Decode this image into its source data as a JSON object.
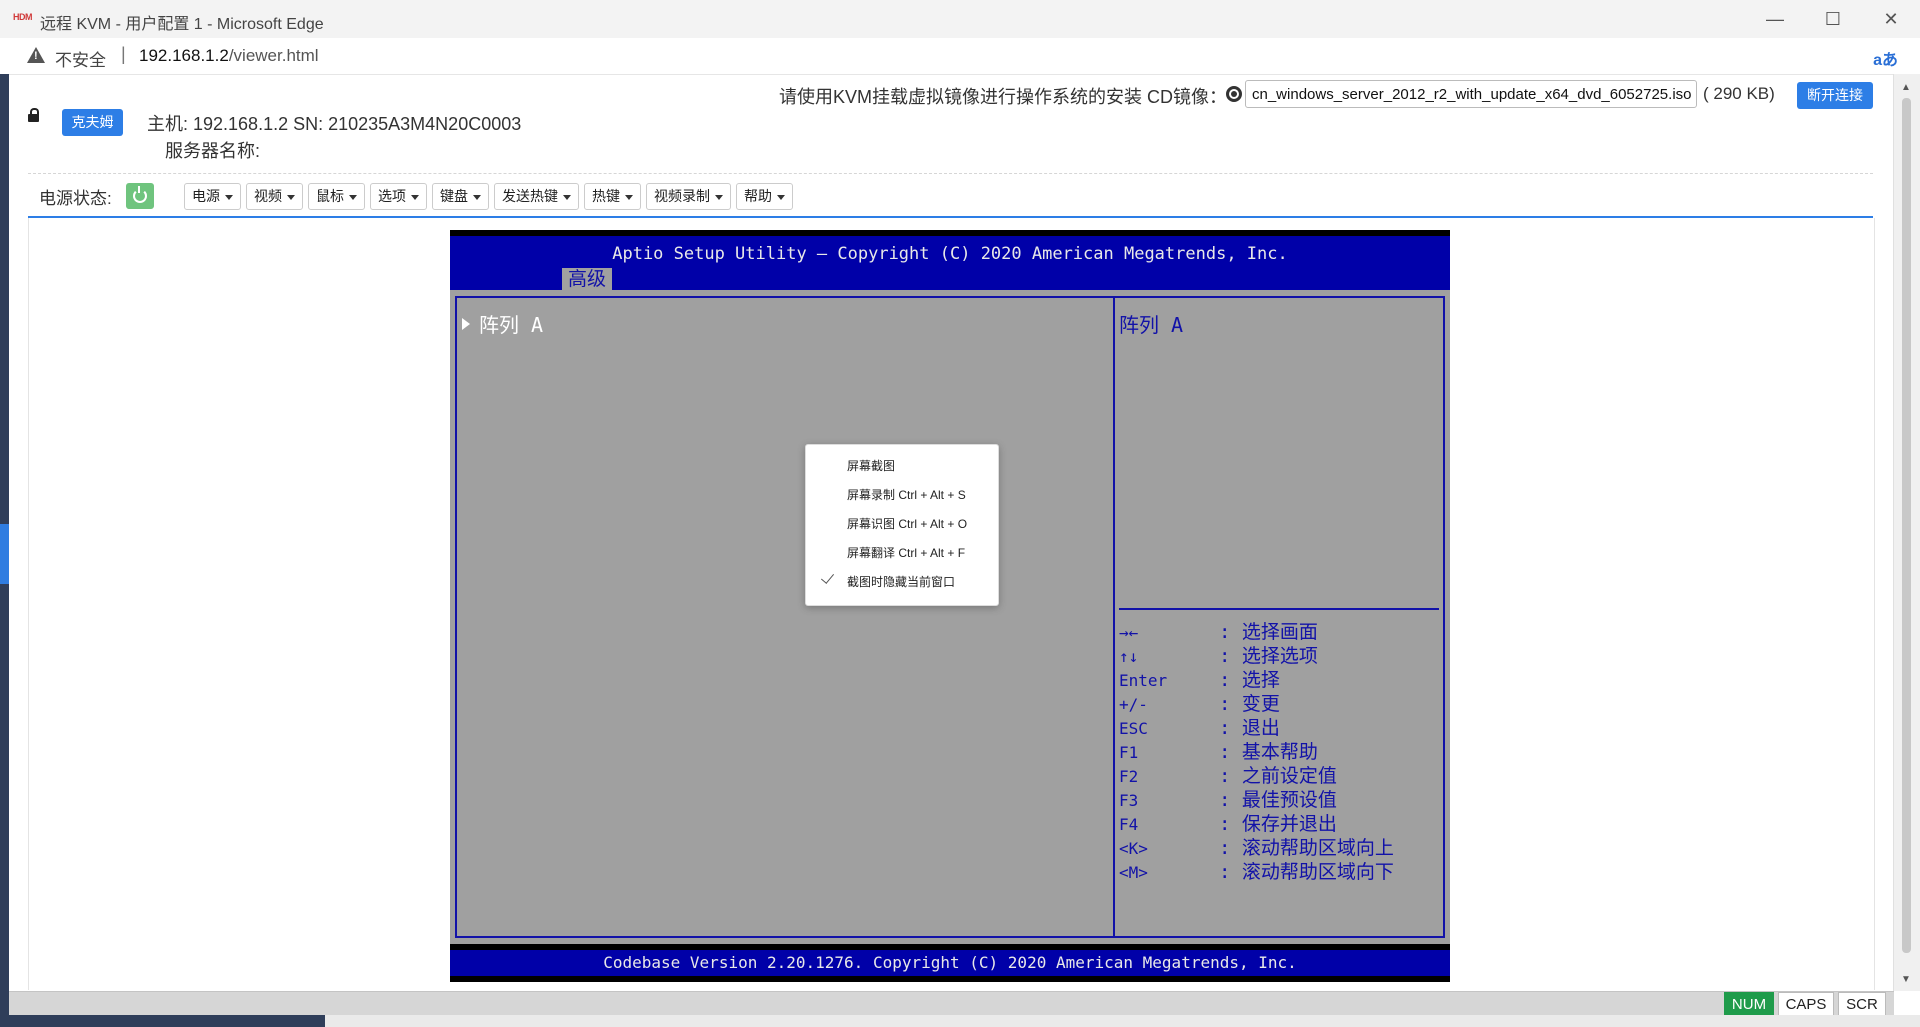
{
  "window": {
    "logo_text": "HDM",
    "title": "远程 KVM - 用户配置 1 - Microsoft Edge",
    "controls": {
      "minimize": "—",
      "maximize": "☐",
      "close": "✕"
    }
  },
  "address_bar": {
    "security_label": "不安全",
    "separator": "|",
    "url_host": "192.168.1.2",
    "url_path": "/viewer.html",
    "read_aloud_icon": "aあ"
  },
  "header": {
    "username": "克夫姆",
    "host_label": "主机:   192.168.1.2  SN:   210235A3M4N20C0003",
    "server_name_label": "服务器名称:",
    "notice": "请使用KVM挂载虚拟镜像进行操作系统的安装   CD镜像：",
    "iso_name": "cn_windows_server_2012_r2_with_update_x64_dvd_6052725.iso",
    "iso_size": "( 290 KB)",
    "disconnect": "断开连接"
  },
  "toolbar": {
    "power_status_label": "电源状态:",
    "power_color": "#6fc47e",
    "menus": [
      "电源",
      "视频",
      "鼠标",
      "选项",
      "键盘",
      "发送热键",
      "热键",
      "视频录制",
      "帮助"
    ]
  },
  "bios": {
    "title": "Aptio Setup Utility – Copyright (C) 2020 American Megatrends, Inc.",
    "tab": "高级",
    "left_item": "阵列 A",
    "help_title": "阵列 A",
    "keys": [
      {
        "key": "→←",
        "desc": ": 选择画面"
      },
      {
        "key": "↑↓",
        "desc": ": 选择选项"
      },
      {
        "key": "Enter",
        "desc": ": 选择"
      },
      {
        "key": "+/-",
        "desc": ": 变更"
      },
      {
        "key": "ESC",
        "desc": ": 退出"
      },
      {
        "key": "F1",
        "desc": ": 基本帮助"
      },
      {
        "key": "F2",
        "desc": ": 之前设定值"
      },
      {
        "key": "F3",
        "desc": ": 最佳预设值"
      },
      {
        "key": "F4",
        "desc": ": 保存并退出"
      },
      {
        "key": "<K>",
        "desc": ": 滚动帮助区域向上"
      },
      {
        "key": "<M>",
        "desc": ": 滚动帮助区域向下"
      }
    ],
    "footer": "Codebase Version 2.20.1276. Copyright (C) 2020 American Megatrends, Inc.",
    "colors": {
      "blue": "#0000a8",
      "gray": "#a0a0a0"
    }
  },
  "context_menu": {
    "items": [
      "屏幕截图",
      "屏幕录制 Ctrl + Alt + S",
      "屏幕识图 Ctrl + Alt + O",
      "屏幕翻译 Ctrl + Alt + F",
      "截图时隐藏当前窗口"
    ]
  },
  "status_indicators": {
    "num": "NUM",
    "caps": "CAPS",
    "scr": "SCR",
    "num_color": "#1f9b4b"
  }
}
